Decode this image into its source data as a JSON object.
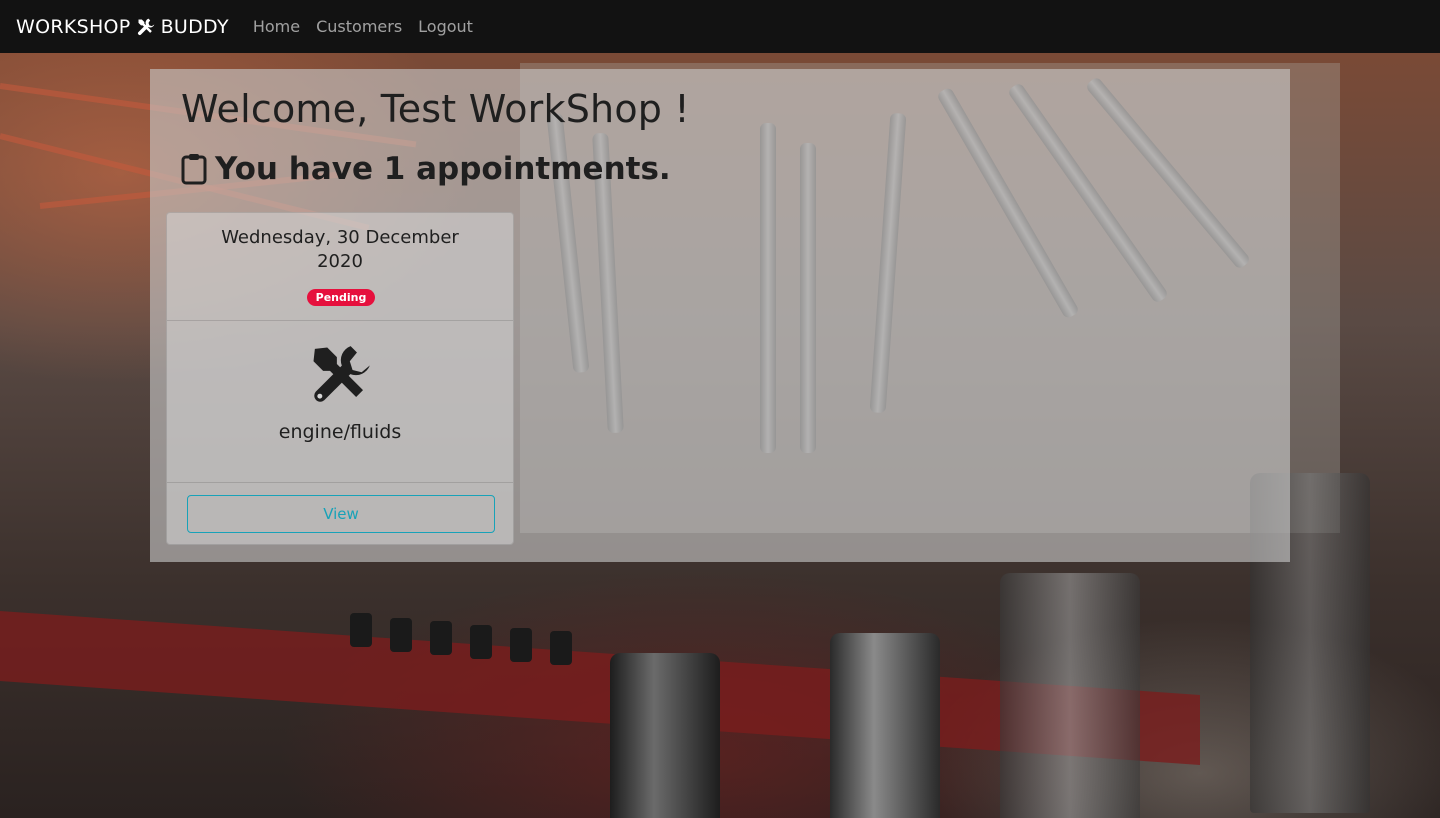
{
  "navbar": {
    "brand_left": "WORKSHOP",
    "brand_right": "BUDDY",
    "brand_icon": "tools-icon",
    "links": [
      "Home",
      "Customers",
      "Logout"
    ]
  },
  "main": {
    "welcome": "Welcome, Test WorkShop !",
    "appointments_icon": "clipboard-icon",
    "appointments_text": "You have 1 appointments.",
    "appointment": {
      "date": "Wednesday, 30 December 2020",
      "status": "Pending",
      "service_icon": "tools-icon",
      "service": "engine/fluids",
      "view_label": "View"
    }
  },
  "colors": {
    "navbar_bg": "#121212",
    "badge_pending": "#e6103d",
    "view_button": "#17a2b8"
  }
}
